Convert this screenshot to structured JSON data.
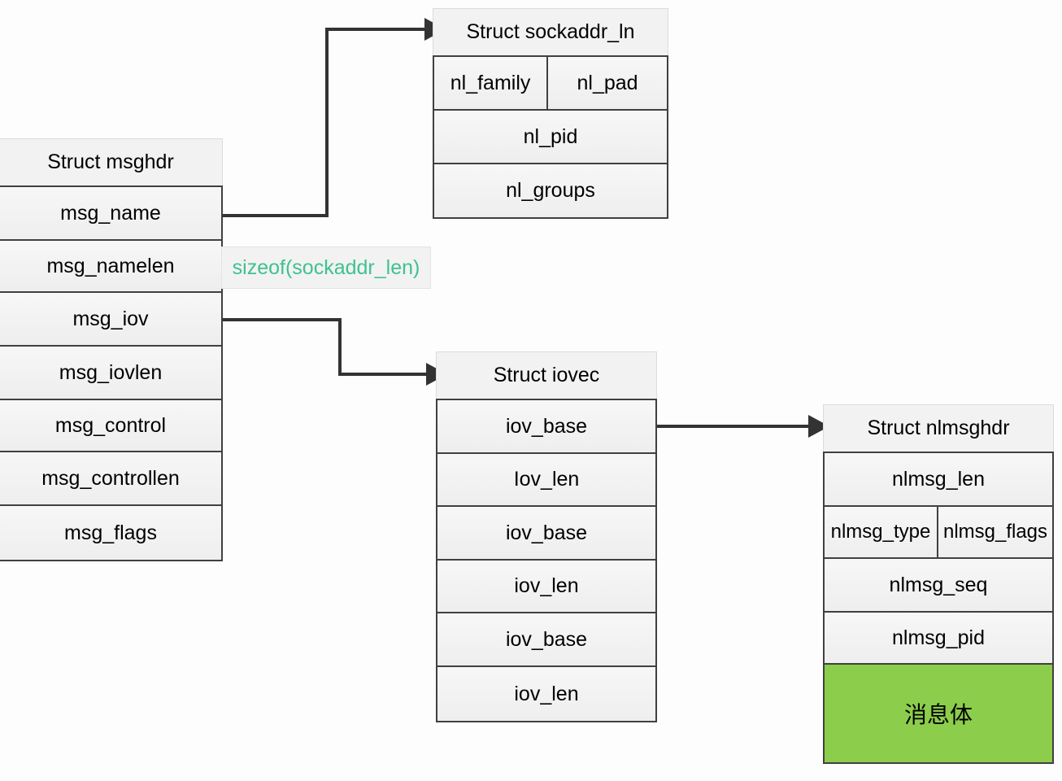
{
  "diagram": {
    "title": "netlink message structure relationship",
    "accent_green_fill": "#8CCD4C",
    "note_text_color": "#3EC28F",
    "line_color": "#333333"
  },
  "structs": {
    "msghdr": {
      "title": "Struct msghdr",
      "rows": [
        {
          "label": "msg_name"
        },
        {
          "label": "msg_namelen"
        },
        {
          "label": "msg_iov"
        },
        {
          "label": "msg_iovlen"
        },
        {
          "label": "msg_control"
        },
        {
          "label": "msg_controllen"
        },
        {
          "label": "msg_flags"
        }
      ]
    },
    "sockaddr_nl": {
      "title": "Struct sockaddr_ln",
      "rows": [
        {
          "left": "nl_family",
          "right": "nl_pad"
        },
        {
          "label": "nl_pid"
        },
        {
          "label": "nl_groups"
        }
      ]
    },
    "iovec": {
      "title": "Struct iovec",
      "rows": [
        {
          "label": "iov_base"
        },
        {
          "label": "Iov_len"
        },
        {
          "label": "iov_base"
        },
        {
          "label": "iov_len"
        },
        {
          "label": "iov_base"
        },
        {
          "label": "iov_len"
        }
      ]
    },
    "nlmsghdr": {
      "title": "Struct nlmsghdr",
      "rows": [
        {
          "label": "nlmsg_len"
        },
        {
          "left": "nlmsg_type",
          "right": "nlmsg_flags"
        },
        {
          "label": "nlmsg_seq"
        },
        {
          "label": "nlmsg_pid"
        },
        {
          "label": "消息体"
        }
      ]
    }
  },
  "notes": {
    "sockaddr_len": "sizeof(sockaddr_len)"
  },
  "connections": {
    "msg_name_to_sockaddr": "msg_name -> Struct sockaddr_ln",
    "msg_iov_to_iovec": "msg_iov -> Struct iovec",
    "iov_base_to_nlmsghdr": "iov_base -> Struct nlmsghdr"
  }
}
